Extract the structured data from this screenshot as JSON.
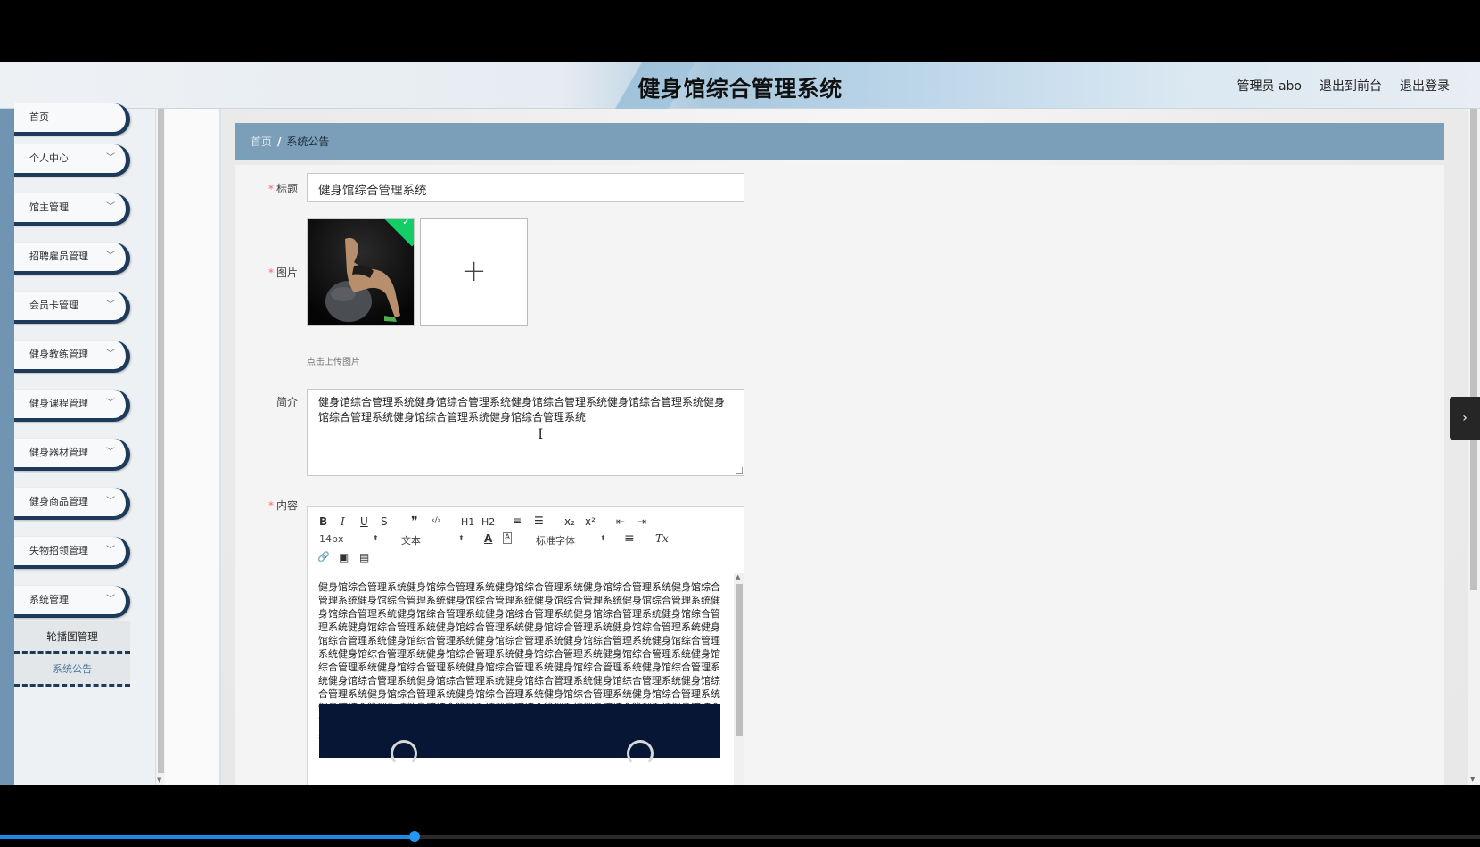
{
  "header": {
    "title": "健身馆综合管理系统",
    "links": [
      "管理员 abo",
      "退出到前台",
      "退出登录"
    ]
  },
  "sidebar": {
    "items": [
      {
        "label": "首页",
        "has_arrow": false
      },
      {
        "label": "个人中心",
        "has_arrow": true
      },
      {
        "label": "馆主管理",
        "has_arrow": true
      },
      {
        "label": "招聘雇员管理",
        "has_arrow": true
      },
      {
        "label": "会员卡管理",
        "has_arrow": true
      },
      {
        "label": "健身教练管理",
        "has_arrow": true
      },
      {
        "label": "健身课程管理",
        "has_arrow": true
      },
      {
        "label": "健身器材管理",
        "has_arrow": true
      },
      {
        "label": "健身商品管理",
        "has_arrow": true
      },
      {
        "label": "失物招领管理",
        "has_arrow": true
      },
      {
        "label": "系统管理",
        "has_arrow": true
      }
    ],
    "submenu": [
      {
        "label": "轮播图管理",
        "active": false
      },
      {
        "label": "系统公告",
        "active": true
      }
    ]
  },
  "breadcrumb": {
    "home": "首页",
    "separator": "/",
    "current": "系统公告"
  },
  "form": {
    "title_label": "标题",
    "title_value": "健身馆综合管理系统",
    "image_label": "图片",
    "upload_tip": "点击上传图片",
    "upload_plus": "+",
    "intro_label": "简介",
    "intro_value": "健身馆综合管理系统健身馆综合管理系统健身馆综合管理系统健身馆综合管理系统健身馆综合管理系统健身馆综合管理系统健身馆综合管理系统",
    "content_label": "内容",
    "required_mark": "*"
  },
  "editor": {
    "toolbar_row1": [
      "B",
      "I",
      "U",
      "S",
      "❞",
      "‹/›",
      "H1",
      "H2",
      "≡",
      "☰",
      "x₂",
      "x²",
      "⇤",
      "⇥"
    ],
    "size_select": "14px",
    "format_select": "文本",
    "color_icon": "A",
    "bg_icon": "A",
    "font_select": "标准字体",
    "align_icon": "≡",
    "clear_icon": "Tx",
    "toolbar_row3": [
      "🔗",
      "▣",
      "▤"
    ],
    "content": "健身馆综合管理系统健身馆综合管理系统健身馆综合管理系统健身馆综合管理系统健身馆综合管理系统健身馆综合管理系统健身馆综合管理系统健身馆综合管理系统健身馆综合管理系统健身馆综合管理系统健身馆综合管理系统健身馆综合管理系统健身馆综合管理系统健身馆综合管理系统健身馆综合管理系统健身馆综合管理系统健身馆综合管理系统健身馆综合管理系统健身馆综合管理系统健身馆综合管理系统健身馆综合管理系统健身馆综合管理系统健身馆综合管理系统健身馆综合管理系统健身馆综合管理系统健身馆综合管理系统健身馆综合管理系统健身馆综合管理系统健身馆综合管理系统健身馆综合管理系统健身馆综合管理系统健身馆综合管理系统健身馆综合管理系统健身馆综合管理系统健身馆综合管理系统健身馆综合管理系统健身馆综合管理系统健身馆综合管理系统健身馆综合管理系统健身馆综合管理系统健身馆综合管理系统健身馆综合管理系统健身馆综合管理系统健身馆综合管理系统健身馆综合管理系统健身馆综合管理系统健身馆综合管理系统健身馆综合管理系统健身馆综合管理系统健身馆综合管理系统健身馆综合管理系统健身馆综合管理系统健身馆综合管理系统健身馆综合管理系统"
  },
  "icons": {
    "chevron": "chevron-down-icon",
    "check": "check-icon",
    "side_toggle": "chevron-right-icon"
  },
  "colors": {
    "rail": "#6f95b3",
    "breadcrumb_bg": "#7c9fb9",
    "menu_border": "#1d3a5a",
    "required": "#f56c6c",
    "upload_success": "#13ce66"
  },
  "video_progress": 0.28
}
